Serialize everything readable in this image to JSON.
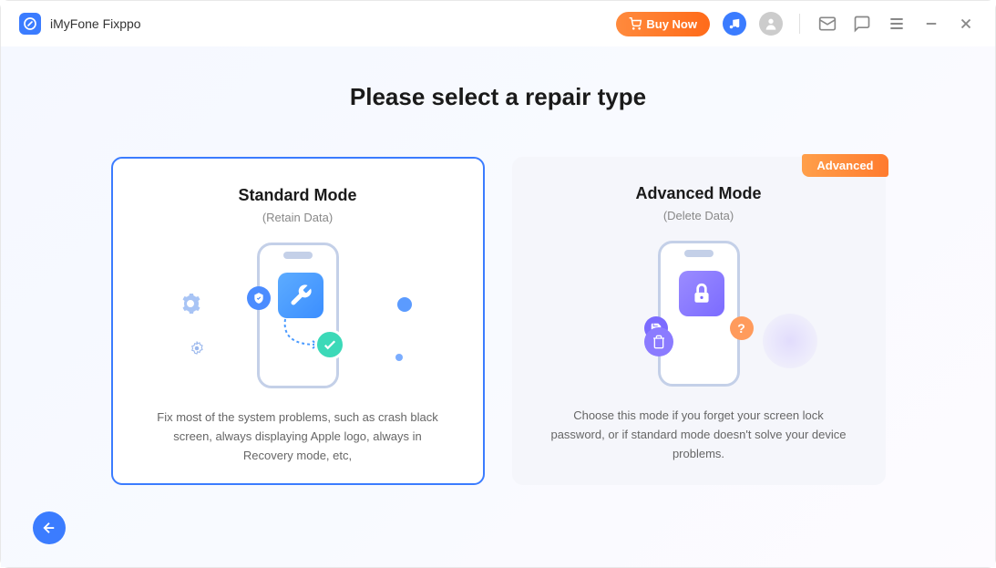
{
  "app": {
    "title": "iMyFone Fixppo"
  },
  "titlebar": {
    "buy_now_label": "Buy Now"
  },
  "page": {
    "title": "Please select a repair type"
  },
  "cards": {
    "standard": {
      "title": "Standard Mode",
      "subtitle": "(Retain Data)",
      "description": "Fix most of the system problems, such as crash black screen, always displaying Apple logo, always in Recovery mode, etc,"
    },
    "advanced": {
      "badge": "Advanced",
      "title": "Advanced Mode",
      "subtitle": "(Delete Data)",
      "description": "Choose this mode if you forget your screen lock password, or if standard mode doesn't solve your device problems."
    }
  }
}
